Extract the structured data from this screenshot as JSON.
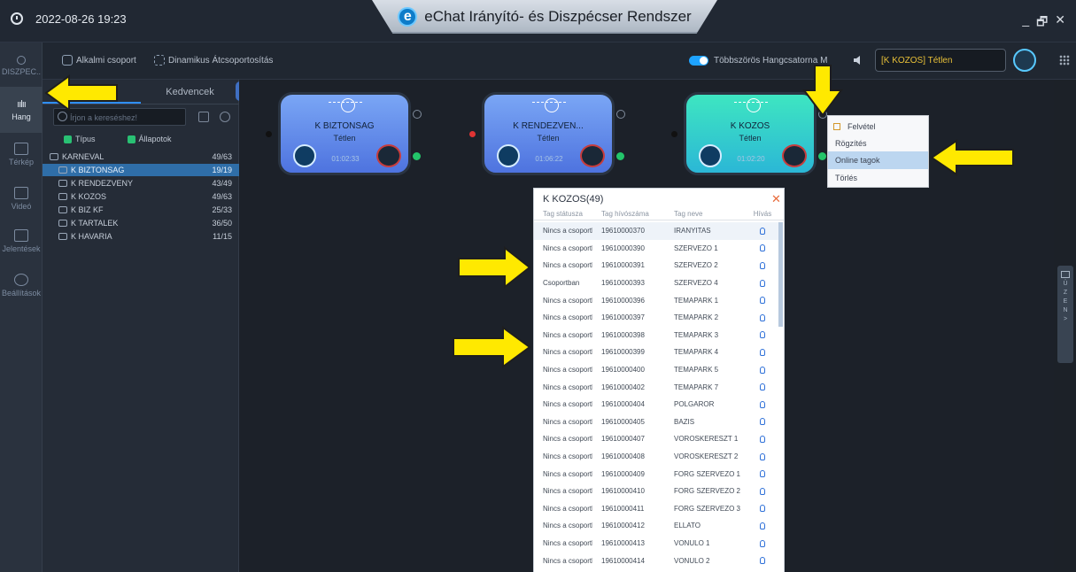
{
  "titlebar": {
    "datetime": "2022-08-26 19:23",
    "app_title": "eChat Irányító-  és Diszpécser Rendszer",
    "logo_letter": "e",
    "window_controls": [
      "_",
      "🗗",
      "✕"
    ]
  },
  "toolbar": {
    "temporary_group": "Alkalmi csoport",
    "dynamic_regroup": "Dinamikus Átcsoportosítás",
    "multi_channel": "Többszörös Hangcsatorna M",
    "status_group": "[K KOZOS]",
    "status_text": "Tétlen"
  },
  "leftnav": {
    "items": [
      {
        "label": "DISZPEC..",
        "icon": "person-icon"
      },
      {
        "label": "Hang",
        "icon": "waveform-icon"
      },
      {
        "label": "Térkép",
        "icon": "map-icon"
      },
      {
        "label": "Videó",
        "icon": "video-icon"
      },
      {
        "label": "Jelentések",
        "icon": "calendar-icon"
      },
      {
        "label": "Beállítások",
        "icon": "gear-icon"
      }
    ]
  },
  "panel": {
    "tab_left": "",
    "tab_right": "Kedvencek",
    "search_placeholder": "Írjon a kereséshez!",
    "filter_type": "Típus",
    "filter_states": "Állapotok",
    "tree": [
      {
        "name": "KARNEVAL",
        "count": "49/63",
        "level": 0
      },
      {
        "name": "K BIZTONSAG",
        "count": "19/19",
        "level": 1,
        "selected": true
      },
      {
        "name": "K RENDEZVENY",
        "count": "43/49",
        "level": 1
      },
      {
        "name": "K KOZOS",
        "count": "49/63",
        "level": 1
      },
      {
        "name": "K BIZ KF",
        "count": "25/33",
        "level": 1
      },
      {
        "name": "K TARTALEK",
        "count": "36/50",
        "level": 1
      },
      {
        "name": "K HAVARIA",
        "count": "11/15",
        "level": 1
      }
    ]
  },
  "cards": [
    {
      "name": "K BIZTONSAG",
      "status": "Tétlen",
      "time": "01:02:33",
      "color_top": "#7aa6f5",
      "color_bottom": "#4e73df"
    },
    {
      "name": "K RENDEZVEN...",
      "status": "Tétlen",
      "time": "01:06:22",
      "color_top": "#7aa6f5",
      "color_bottom": "#4e73df"
    },
    {
      "name": "K KOZOS",
      "status": "Tétlen",
      "time": "01:02:20",
      "color_top": "#3ee6c1",
      "color_bottom": "#2bb7d6"
    }
  ],
  "context_menu": {
    "items": [
      "Felvétel",
      "Rögzítés",
      "Online tagok",
      "Törlés"
    ]
  },
  "popup": {
    "title": "K KOZOS(49)",
    "close": "✕",
    "headers": [
      "Tag státusza",
      "Tag hívószáma",
      "Tag neve",
      "Hívás"
    ],
    "rows": [
      [
        "Nincs a csoportban",
        "19610000370",
        "IRANYITAS"
      ],
      [
        "Nincs a csoportban",
        "19610000390",
        "SZERVEZO 1"
      ],
      [
        "Nincs a csoportban",
        "19610000391",
        "SZERVEZO 2"
      ],
      [
        "Csoportban",
        "19610000393",
        "SZERVEZO 4"
      ],
      [
        "Nincs a csoportban",
        "19610000396",
        "TEMAPARK 1"
      ],
      [
        "Nincs a csoportban",
        "19610000397",
        "TEMAPARK 2"
      ],
      [
        "Nincs a csoportban",
        "19610000398",
        "TEMAPARK 3"
      ],
      [
        "Nincs a csoportban",
        "19610000399",
        "TEMAPARK 4"
      ],
      [
        "Nincs a csoportban",
        "19610000400",
        "TEMAPARK 5"
      ],
      [
        "Nincs a csoportban",
        "19610000402",
        "TEMAPARK 7"
      ],
      [
        "Nincs a csoportban",
        "19610000404",
        "POLGAROR"
      ],
      [
        "Nincs a csoportban",
        "19610000405",
        "BAZIS"
      ],
      [
        "Nincs a csoportban",
        "19610000407",
        "VOROSKERESZT 1"
      ],
      [
        "Nincs a csoportban",
        "19610000408",
        "VOROSKERESZT 2"
      ],
      [
        "Nincs a csoportban",
        "19610000409",
        "FORG SZERVEZO 1"
      ],
      [
        "Nincs a csoportban",
        "19610000410",
        "FORG SZERVEZO 2"
      ],
      [
        "Nincs a csoportban",
        "19610000411",
        "FORG SZERVEZO 3"
      ],
      [
        "Nincs a csoportban",
        "19610000412",
        "ELLATO"
      ],
      [
        "Nincs a csoportban",
        "19610000413",
        "VONULO 1"
      ],
      [
        "Nincs a csoportban",
        "19610000414",
        "VONULO 2"
      ]
    ]
  },
  "side_tab": {
    "letters": [
      "Ü",
      "Z",
      "E",
      "N",
      ">"
    ]
  },
  "colors": {
    "accent": "#2f8fff",
    "arrow": "#ffe900",
    "online": "#23c56a"
  }
}
